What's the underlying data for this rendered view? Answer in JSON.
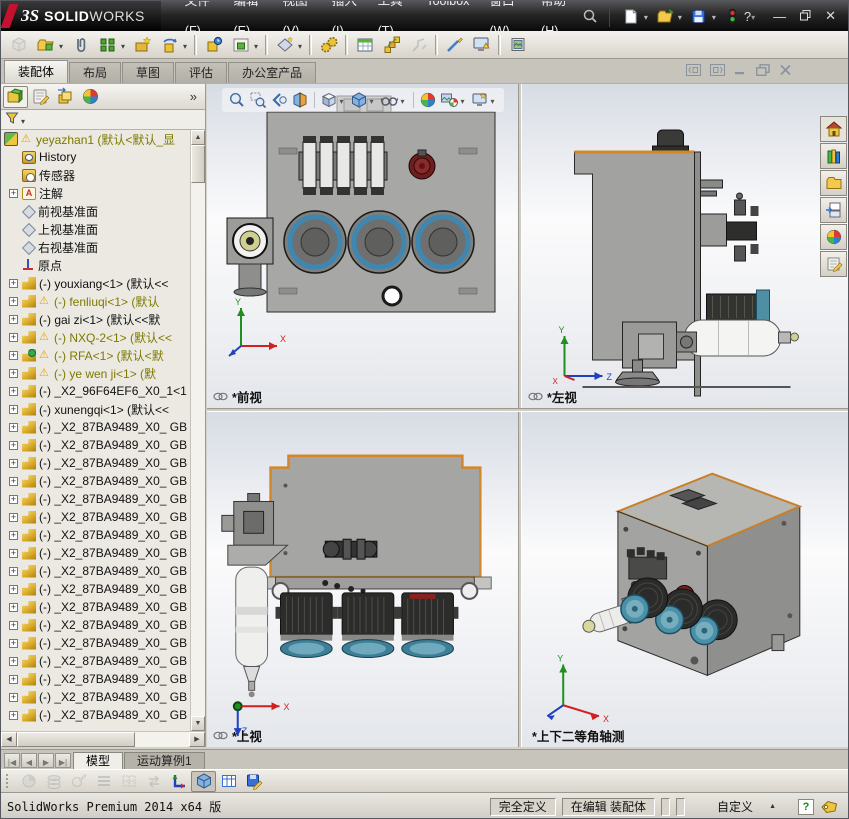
{
  "window": {
    "brand_prefix": "ЗS",
    "brand_bold": "SOLID",
    "brand_rest": "WORKS",
    "menus": [
      {
        "label": "文件(F)"
      },
      {
        "label": "编辑(E)"
      },
      {
        "label": "视图(V)"
      },
      {
        "label": "插入(I)"
      },
      {
        "label": "工具(T)"
      },
      {
        "label": "Toolbox"
      },
      {
        "label": "窗口(W)"
      },
      {
        "label": "帮助(H)"
      }
    ],
    "quick_icons": [
      "new-document",
      "open-document",
      "save",
      "traffic-light"
    ],
    "window_icons": [
      "help",
      "minimize",
      "restore",
      "close"
    ]
  },
  "main_toolbar_icons": [
    "edit-component",
    "insert-component",
    "mate",
    "linear-component-pattern",
    "smart-fasteners",
    "move-component",
    "show-hidden-components",
    "assembly-features",
    "reference-geometry",
    "new-motion-study",
    "bill-of-materials",
    "exploded-view",
    "explode-line-sketch",
    "interference-detection",
    "assembly-xpert",
    "snapshot"
  ],
  "command_tabs": [
    {
      "label": "装配体",
      "cls": "active"
    },
    {
      "label": "布局"
    },
    {
      "label": "草图"
    },
    {
      "label": "评估"
    },
    {
      "label": "办公室产品"
    }
  ],
  "doc_window_icons": [
    "span-left",
    "span-right",
    "minimize",
    "restore",
    "close"
  ],
  "feature_panel": {
    "header_icons": [
      "featuremanager-tree",
      "propertymanager",
      "configurationmanager",
      "displaymanager"
    ],
    "expand_chevron": "»",
    "filter_icon": "filter-funnel",
    "root": {
      "label": "yeyazhan1 (默认<默认_显"
    },
    "items": [
      {
        "cls": "history",
        "label": "History"
      },
      {
        "cls": "sensors",
        "label": "传感器"
      },
      {
        "cls": "ann exp",
        "label": "注解"
      },
      {
        "cls": "plane",
        "label": "前视基准面"
      },
      {
        "cls": "plane",
        "label": "上视基准面"
      },
      {
        "cls": "plane",
        "label": "右视基准面"
      },
      {
        "cls": "origin",
        "label": "原点"
      },
      {
        "cls": "part exp",
        "label": "(-) youxiang<1> (默认<<"
      },
      {
        "cls": "part exp warn",
        "label": "(-) fenliuqi<1> (默认"
      },
      {
        "cls": "part exp",
        "label": "(-) gai zi<1> (默认<<默"
      },
      {
        "cls": "part exp warn",
        "label": "(-) NXQ-2<1> (默认<<"
      },
      {
        "cls": "part exp warn grn",
        "label": "(-) RFA<1> (默认<默"
      },
      {
        "cls": "part exp warn",
        "label": "(-) ye wen ji<1> (默"
      },
      {
        "cls": "part exp",
        "label": "(-) _X2_96F64EF6_X0_1<1"
      },
      {
        "cls": "part exp",
        "label": "(-) xunengqi<1> (默认<<"
      },
      {
        "cls": "part exp",
        "label": "(-) _X2_87BA9489_X0_ GB"
      },
      {
        "cls": "part exp",
        "label": "(-) _X2_87BA9489_X0_ GB"
      },
      {
        "cls": "part exp",
        "label": "(-) _X2_87BA9489_X0_ GB"
      },
      {
        "cls": "part exp",
        "label": "(-) _X2_87BA9489_X0_ GB"
      },
      {
        "cls": "part exp",
        "label": "(-) _X2_87BA9489_X0_ GB"
      },
      {
        "cls": "part exp",
        "label": "(-) _X2_87BA9489_X0_ GB"
      },
      {
        "cls": "part exp",
        "label": "(-) _X2_87BA9489_X0_ GB"
      },
      {
        "cls": "part exp",
        "label": "(-) _X2_87BA9489_X0_ GB"
      },
      {
        "cls": "part exp",
        "label": "(-) _X2_87BA9489_X0_ GB"
      },
      {
        "cls": "part exp",
        "label": "(-) _X2_87BA9489_X0_ GB"
      },
      {
        "cls": "part exp",
        "label": "(-) _X2_87BA9489_X0_ GB"
      },
      {
        "cls": "part exp",
        "label": "(-) _X2_87BA9489_X0_ GB"
      },
      {
        "cls": "part exp",
        "label": "(-) _X2_87BA9489_X0_ GB"
      },
      {
        "cls": "part exp",
        "label": "(-) _X2_87BA9489_X0_ GB"
      },
      {
        "cls": "part exp",
        "label": "(-) _X2_87BA9489_X0_ GB"
      },
      {
        "cls": "part exp",
        "label": "(-) _X2_87BA9489_X0_ GB"
      },
      {
        "cls": "part exp",
        "label": "(-) _X2_87BA9489_X0_ GB"
      }
    ]
  },
  "headsup_icons": [
    "zoom-to-fit",
    "zoom-to-area",
    "previous-view",
    "section-view",
    "view-orientation",
    "display-style",
    "hide-show-items",
    "edit-appearance",
    "apply-scene",
    "view-settings"
  ],
  "task_pane_icons": [
    "solidworks-resources",
    "design-library",
    "file-explorer",
    "view-palette",
    "appearances-scenes",
    "custom-properties"
  ],
  "viewports": [
    {
      "label": "*前视",
      "linked": true
    },
    {
      "label": "*左视",
      "linked": true
    },
    {
      "label": "*上视",
      "linked": true
    },
    {
      "label": "*上下二等角轴测",
      "linked": false
    }
  ],
  "model_tabs": {
    "nav_icons": [
      "first",
      "previous",
      "next",
      "last"
    ],
    "tabs": [
      {
        "label": "模型",
        "cls": "active"
      },
      {
        "label": "运动算例1"
      }
    ]
  },
  "bottom_toolbar_icons": [
    "mass-properties",
    "stacked-sheets",
    "markup",
    "lines",
    "grid",
    "swap-arrows",
    "reference-triad",
    "shaded-view",
    "table-view",
    "design-table-save"
  ],
  "status_bar": {
    "app_version": "SolidWorks Premium 2014 x64 版",
    "define_state": "完全定义",
    "edit_state": "在编辑 装配体",
    "custom": "自定义",
    "help_glyph": "?"
  },
  "colors": {
    "accent_orange": "#d2882a",
    "motor_blue": "#4a90a8",
    "plate_gray": "#a7a7a5",
    "warning_olive": "#7d7a00",
    "brand_red": "#c31230",
    "toolbar_bg": "#d6d2ca",
    "titlebar": "#1e1e1e"
  }
}
